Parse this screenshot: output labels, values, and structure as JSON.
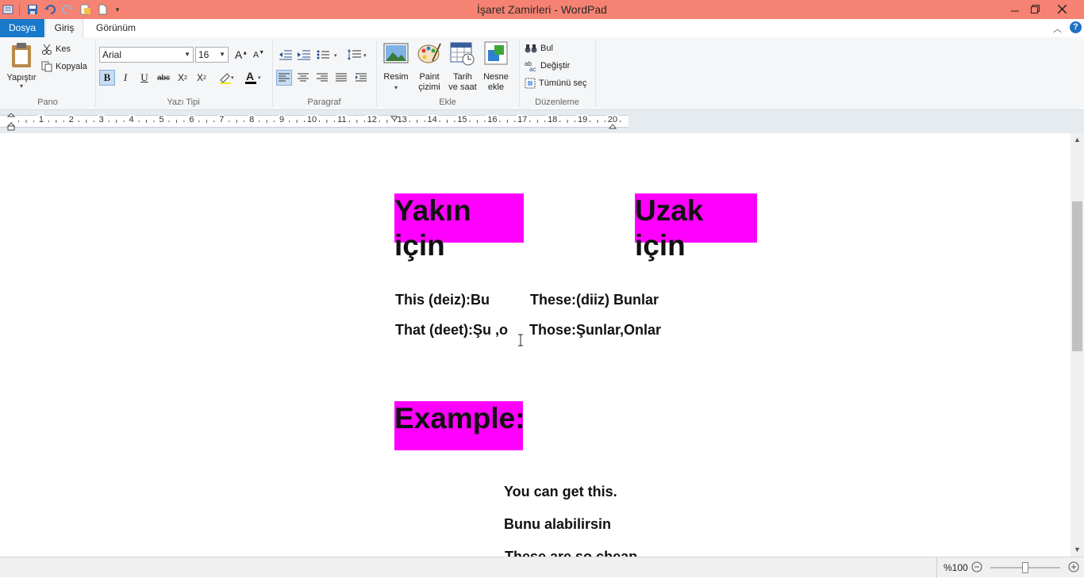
{
  "window": {
    "title": "İşaret Zamirleri - WordPad"
  },
  "tabs": [
    "Dosya",
    "Giriş",
    "Görünüm"
  ],
  "clipboard": {
    "paste": "Yapıştır",
    "cut": "Kes",
    "copy": "Kopyala",
    "group": "Pano"
  },
  "font": {
    "family": "Arial",
    "size": "16",
    "group": "Yazı Tipi"
  },
  "paragraph": {
    "group": "Paragraf"
  },
  "insert": {
    "picture": "Resim",
    "paint_line1": "Paint",
    "paint_line2": "çizimi",
    "datetime_line1": "Tarih",
    "datetime_line2": "ve saat",
    "object_line1": "Nesne",
    "object_line2": "ekle",
    "group": "Ekle"
  },
  "editing": {
    "find": "Bul",
    "replace": "Değiştir",
    "select_all": "Tümünü seç",
    "group": "Düzenleme"
  },
  "ruler": {
    "numbers": [
      "1",
      "2",
      "3",
      "4",
      "5",
      "6",
      "7",
      "8",
      "9",
      "10",
      "11",
      "12",
      "13",
      "14",
      "15",
      "16",
      "17",
      "18",
      "19",
      "20"
    ]
  },
  "document": {
    "heading_near": "Yakın için",
    "heading_far": "Uzak için",
    "row1_left": "This (deiz):Bu",
    "row1_right": "These:(diiz) Bunlar",
    "row2_left": "That (deet):Şu ,o",
    "row2_right": "Those:Şunlar,Onlar",
    "heading_example": "Example:",
    "ex1": "You can get this.",
    "ex2": "Bunu alabilirsin",
    "ex3": "These are so cheap"
  },
  "status": {
    "zoom": "%100",
    "zoom_fraction": 0.5
  }
}
